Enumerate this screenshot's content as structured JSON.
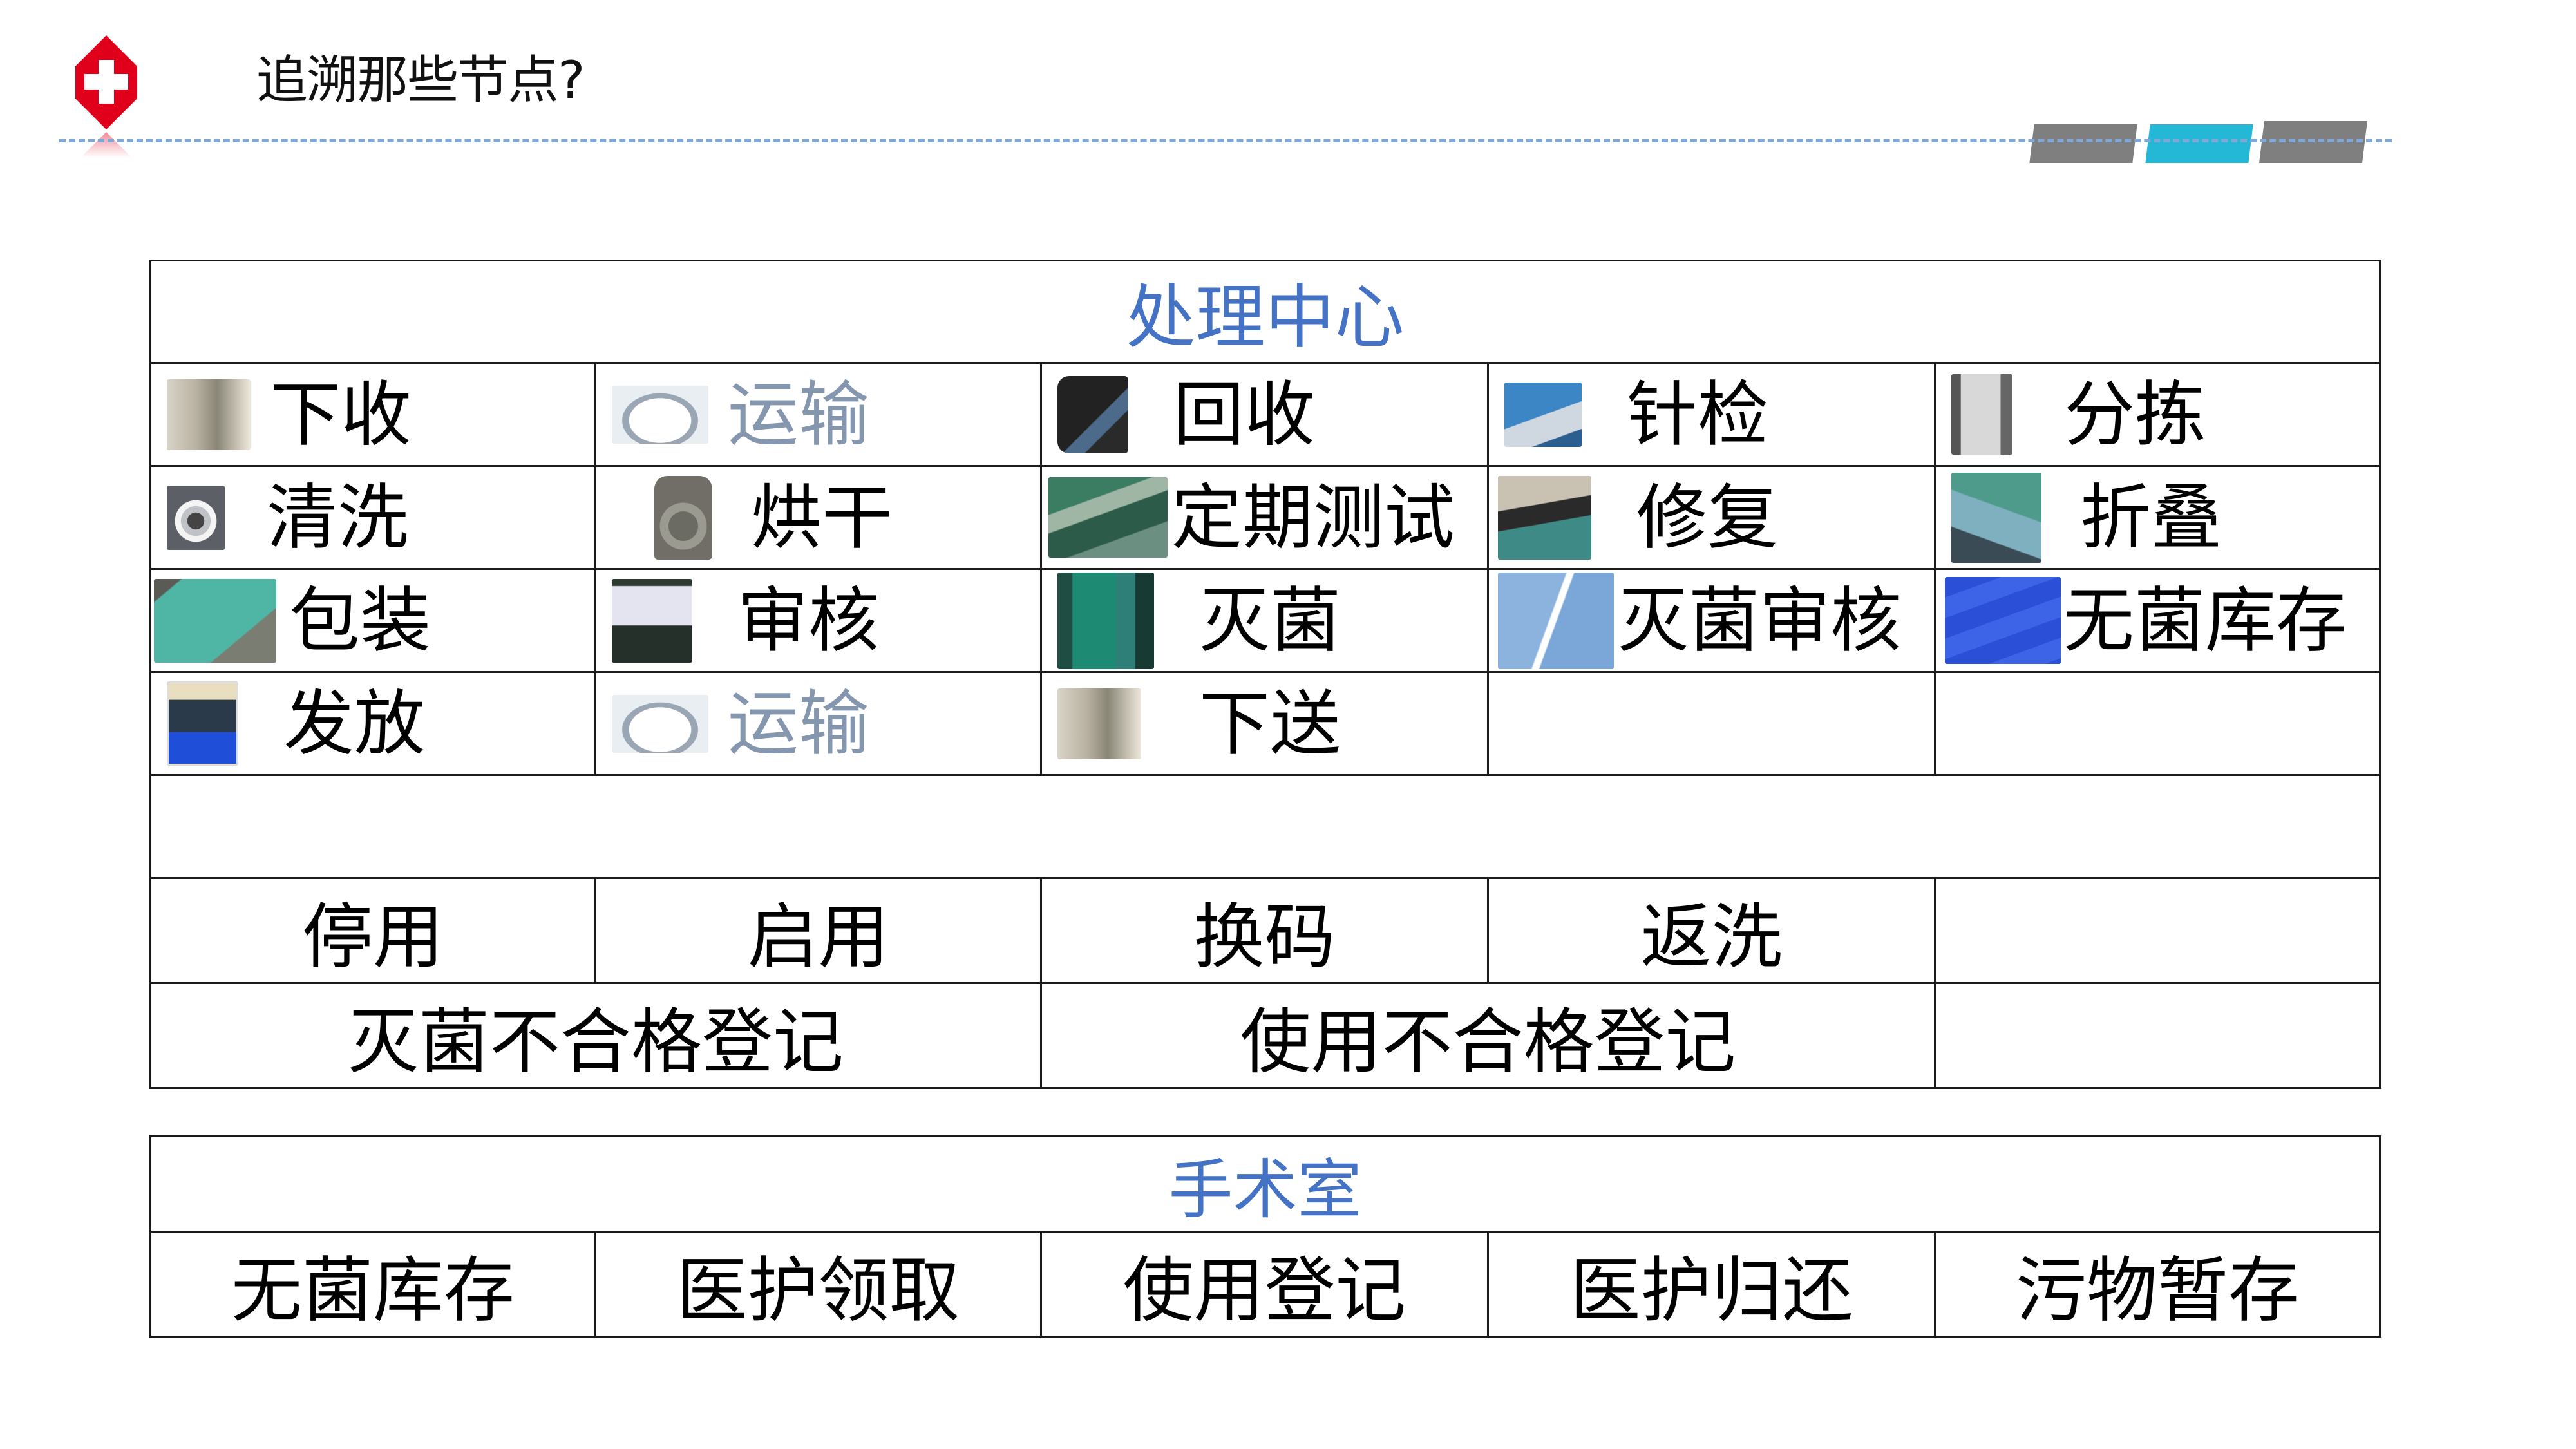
{
  "slide": {
    "title": "追溯那些节点?",
    "logo_icon": "red-cross-icon",
    "accent_colors": {
      "header_text": "#4472c4",
      "grey_text": "#8597ae",
      "tab_grey": "#7f7f7f",
      "tab_active": "#24b8d6",
      "logo_red": "#e0001b",
      "divider": "#7fa7d8"
    },
    "page_indicator": {
      "count": 3,
      "active_index": 1
    }
  },
  "processing_center": {
    "title": "处理中心",
    "rows": [
      [
        {
          "label": "下收",
          "icon": "corridor-photo-icon"
        },
        {
          "label": "运输",
          "icon": "ambulance-photo-icon",
          "muted": true
        },
        {
          "label": "回收",
          "icon": "handheld-scanner-icon"
        },
        {
          "label": "针检",
          "icon": "metal-detector-icon"
        },
        {
          "label": "分拣",
          "icon": "xray-machine-icon"
        }
      ],
      [
        {
          "label": "清洗",
          "icon": "washer-icon"
        },
        {
          "label": "烘干",
          "icon": "dryer-icon"
        },
        {
          "label": "定期测试",
          "icon": "testing-photo-icon"
        },
        {
          "label": "修复",
          "icon": "repair-photo-icon"
        },
        {
          "label": "折叠",
          "icon": "folding-photo-icon"
        }
      ],
      [
        {
          "label": "包装",
          "icon": "package-photo-icon"
        },
        {
          "label": "审核",
          "icon": "monitor-photo-icon"
        },
        {
          "label": "灭菌",
          "icon": "sterilizer-photo-icon"
        },
        {
          "label": "灭菌审核",
          "icon": "sterile-packs-icon"
        },
        {
          "label": "无菌库存",
          "icon": "sterile-storage-icon"
        }
      ],
      [
        {
          "label": "发放",
          "icon": "issue-photo-icon"
        },
        {
          "label": "运输",
          "icon": "ambulance-photo-icon",
          "muted": true
        },
        {
          "label": "下送",
          "icon": "corridor-photo-icon"
        },
        {
          "label": ""
        },
        {
          "label": ""
        }
      ]
    ],
    "exception_row": [
      "停用",
      "启用",
      "换码",
      "返洗",
      ""
    ],
    "register_row": [
      "灭菌不合格登记",
      "使用不合格登记",
      ""
    ]
  },
  "operating_room": {
    "title": "手术室",
    "row": [
      "无菌库存",
      "医护领取",
      "使用登记",
      "医护归还",
      "污物暂存"
    ]
  }
}
